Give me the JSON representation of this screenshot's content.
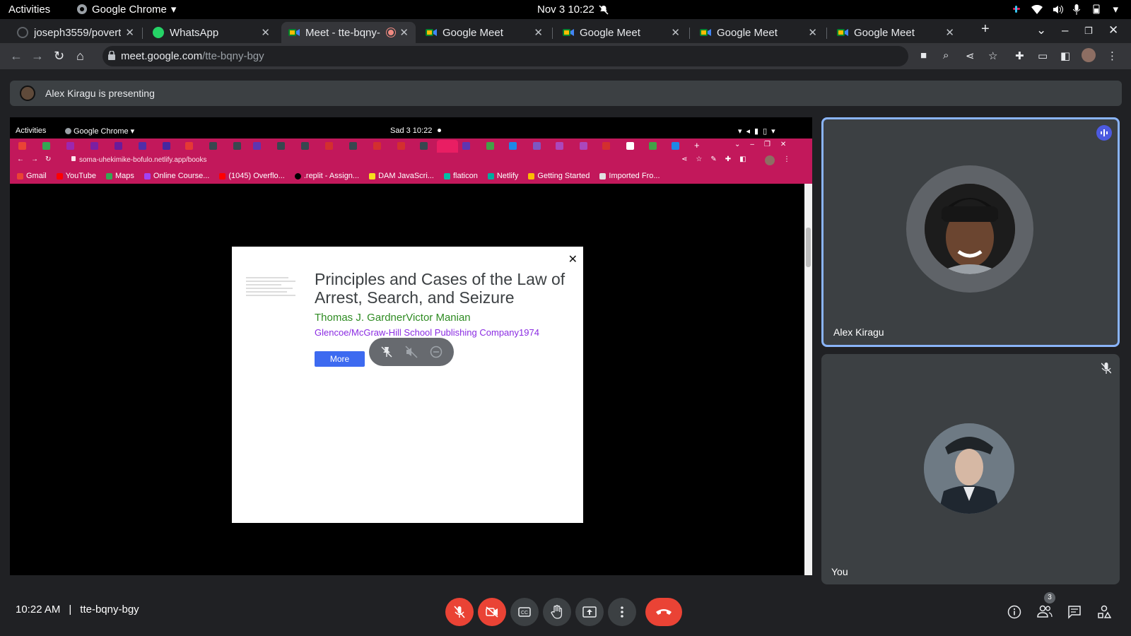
{
  "gnome": {
    "activities": "Activities",
    "app_name": "Google Chrome",
    "clock": "Nov 3  10:22"
  },
  "chrome": {
    "tabs": [
      {
        "title": "joseph3559/poverty",
        "favicon": "github-icon"
      },
      {
        "title": "WhatsApp",
        "favicon": "whatsapp-icon"
      },
      {
        "title": "Meet - tte-bqny-",
        "favicon": "meet-icon",
        "active": true,
        "recording": true
      },
      {
        "title": "Google Meet",
        "favicon": "meet-icon"
      },
      {
        "title": "Google Meet",
        "favicon": "meet-icon"
      },
      {
        "title": "Google Meet",
        "favicon": "meet-icon"
      },
      {
        "title": "Google Meet",
        "favicon": "meet-icon"
      }
    ],
    "url_host": "meet.google.com",
    "url_path": "/tte-bqny-bgy"
  },
  "meet": {
    "presenting_banner": "Alex Kiragu is presenting",
    "time": "10:22 AM",
    "separator": "|",
    "meeting_code": "tte-bqny-bgy",
    "participant_count": "3",
    "tiles": [
      {
        "name": "Alex Kiragu",
        "speaking": true
      },
      {
        "name": "You",
        "muted": true
      }
    ]
  },
  "shared_screen": {
    "gnome": {
      "activities": "Activities",
      "app_name": "Google Chrome",
      "clock": "Sad 3  10:22"
    },
    "url": "soma-uhekimike-bofulo.netlify.app/books",
    "bookmarks": [
      "Gmail",
      "YouTube",
      "Maps",
      "Online Course...",
      "(1045) Overflo...",
      ".replit - Assign...",
      "DAM JavaScri...",
      "flaticon",
      "Netlify",
      "Getting Started",
      "Imported Fro..."
    ],
    "book": {
      "title": "Principles and Cases of the Law of Arrest, Search, and Seizure",
      "authors": "Thomas J. GardnerVictor Manian",
      "publisher": "Glencoe/McGraw-Hill School Publishing Company1974",
      "more_label": "More"
    }
  },
  "colors": {
    "meet_bg": "#202124",
    "inner_chrome_theme": "#c2185b",
    "end_call": "#ea4335",
    "speaking_border": "#8ab4f8",
    "author_green": "#2e8b22",
    "publisher_purple": "#8a2be2",
    "more_button": "#3d6af0"
  }
}
